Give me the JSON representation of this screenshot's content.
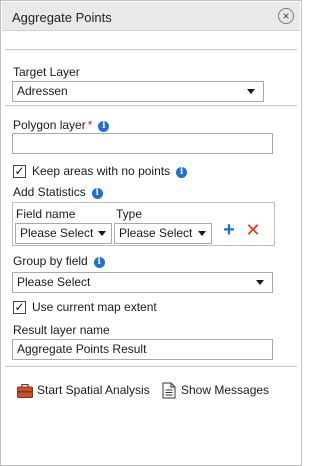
{
  "panel": {
    "title": "Aggregate Points",
    "close_glyph": "×"
  },
  "target_layer": {
    "label": "Target Layer",
    "value": "Adressen"
  },
  "polygon_layer": {
    "label": "Polygon layer",
    "required_mark": "*",
    "value": ""
  },
  "keep_areas": {
    "label": "Keep areas with no points",
    "checked": true
  },
  "add_statistics": {
    "label": "Add Statistics",
    "columns": [
      "Field name",
      "Type"
    ],
    "field_value": "Please Select",
    "type_value": "Please Select"
  },
  "group_by": {
    "label": "Group by field",
    "value": "Please Select"
  },
  "map_extent": {
    "label": "Use current map extent",
    "checked": true
  },
  "result_layer": {
    "label": "Result layer name",
    "value": "Aggregate Points Result"
  },
  "footer": {
    "start_label": "Start Spatial Analysis",
    "messages_label": "Show Messages"
  },
  "icons": {
    "info": "info-icon",
    "add": "plus-icon",
    "remove": "red-x-icon",
    "toolbox": "toolbox-icon",
    "messages": "document-icon"
  },
  "colors": {
    "info_blue": "#1e6fd9",
    "required_red": "#d02020",
    "remove_red": "#d83a1a"
  }
}
